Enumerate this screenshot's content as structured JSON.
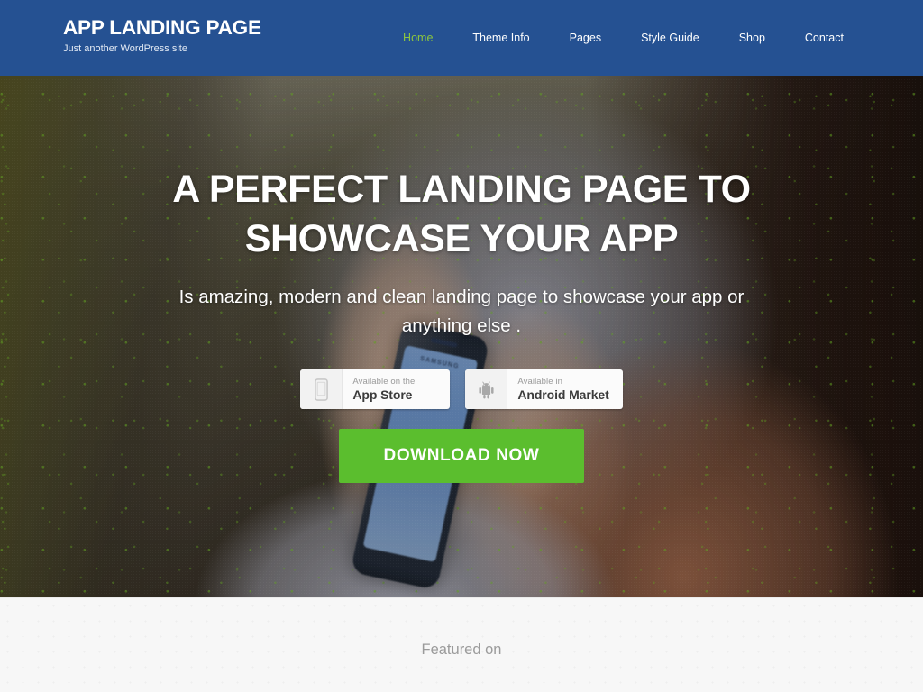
{
  "header": {
    "site_title": "APP LANDING PAGE",
    "tagline": "Just another WordPress site",
    "background_color": "#255192",
    "nav": {
      "items": [
        {
          "label": "Home",
          "active": true
        },
        {
          "label": "Theme Info",
          "active": false
        },
        {
          "label": "Pages",
          "active": false
        },
        {
          "label": "Style Guide",
          "active": false
        },
        {
          "label": "Shop",
          "active": false
        },
        {
          "label": "Contact",
          "active": false
        }
      ],
      "active_color": "#8CC63E",
      "inactive_color": "#ffffff"
    }
  },
  "hero": {
    "title": "A PERFECT LANDING PAGE TO SHOWCASE YOUR APP",
    "subtitle": "Is amazing, modern and clean landing page to showcase your app or anything else .",
    "background_description": "blurred photo of hands holding a blue Samsung smartphone, olive-green foliage at left, dark hair at right",
    "phone_brand": "SAMSUNG",
    "badges": [
      {
        "icon": "phone-icon",
        "small_label": "Available on the",
        "big_label": "App Store"
      },
      {
        "icon": "android-robot-icon",
        "small_label": "Available in",
        "big_label": "Android Market"
      }
    ],
    "cta": {
      "label": "DOWNLOAD NOW",
      "color": "#5BBE2E",
      "text_color": "#ffffff"
    }
  },
  "featured": {
    "label": "Featured on",
    "background_color": "#f7f7f7",
    "text_color": "#9b9b9b"
  }
}
